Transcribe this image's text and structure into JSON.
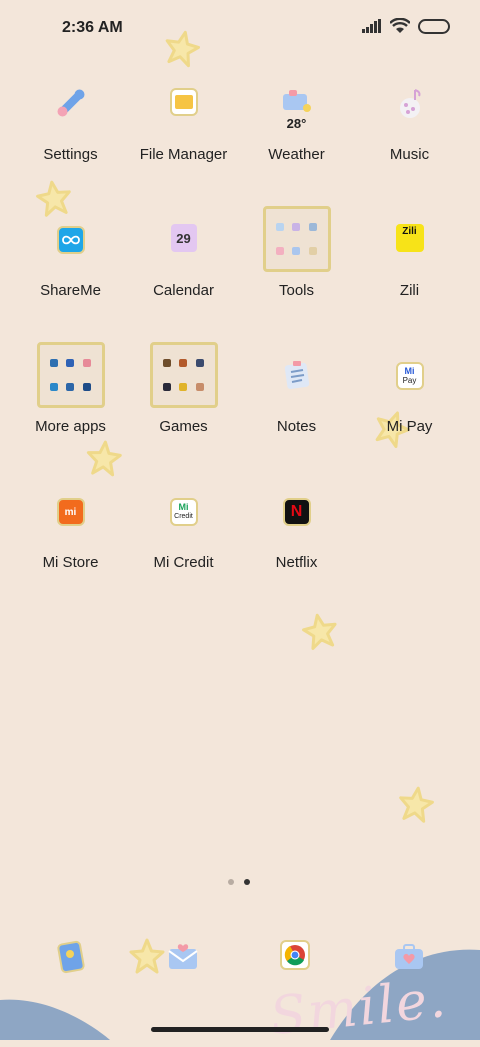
{
  "status_bar": {
    "time": "2:36 AM"
  },
  "apps": [
    {
      "name": "app-settings",
      "label": "Settings"
    },
    {
      "name": "app-file-manager",
      "label": "File Manager"
    },
    {
      "name": "app-weather",
      "label": "Weather",
      "temp": "28°"
    },
    {
      "name": "app-music",
      "label": "Music"
    },
    {
      "name": "app-shareme",
      "label": "ShareMe"
    },
    {
      "name": "app-calendar",
      "label": "Calendar",
      "day": "29"
    },
    {
      "name": "folder-tools",
      "label": "Tools"
    },
    {
      "name": "app-zili",
      "label": "Zili",
      "badge": "Zili"
    },
    {
      "name": "folder-more-apps",
      "label": "More apps"
    },
    {
      "name": "folder-games",
      "label": "Games"
    },
    {
      "name": "app-notes",
      "label": "Notes"
    },
    {
      "name": "app-mi-pay",
      "label": "Mi Pay",
      "badge_top": "Mi",
      "badge_bottom": "Pay"
    },
    {
      "name": "app-mi-store",
      "label": "Mi Store",
      "badge": "mi"
    },
    {
      "name": "app-mi-credit",
      "label": "Mi Credit",
      "badge_top": "Mi",
      "badge_bottom": "Credit"
    },
    {
      "name": "app-netflix",
      "label": "Netflix",
      "badge": "N"
    }
  ],
  "page_indicator": {
    "pages": 2,
    "current": 2
  },
  "wallpaper_text": "Smile.",
  "colors": {
    "background": "#f3e6da",
    "tile_border": "#e1cf8a",
    "star": "#f6e6a8",
    "wave": "#8ea6c4"
  }
}
